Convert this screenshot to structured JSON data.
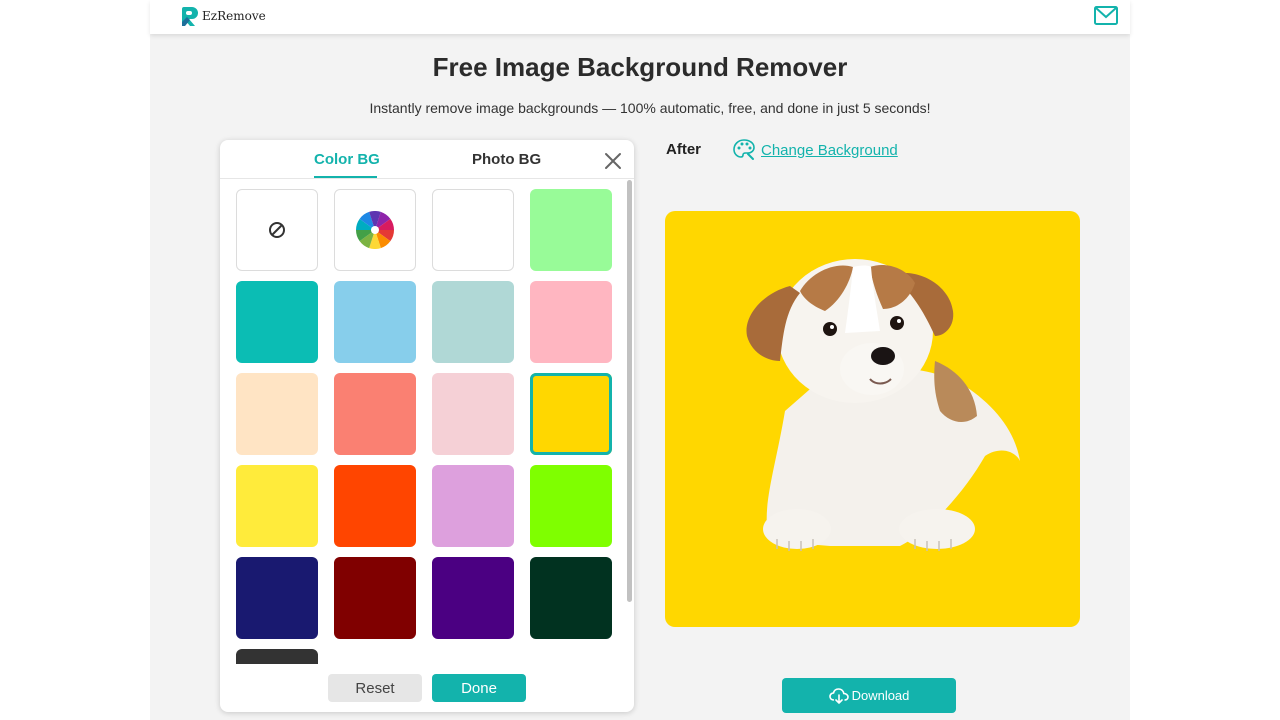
{
  "header": {
    "logo_text": "EzRemove",
    "brand_color": "#13b3ac",
    "mail_icon": "mail-icon"
  },
  "hero": {
    "title": "Free Image Background Remover",
    "subtitle": "Instantly remove image backgrounds — 100% automatic, free, and done in just 5 seconds!"
  },
  "bg_panel": {
    "tabs": [
      {
        "label": "Color BG",
        "active": true
      },
      {
        "label": "Photo BG",
        "active": false
      }
    ],
    "close_icon": "close-icon",
    "swatches": [
      {
        "type": "none",
        "icon": "no-background-icon"
      },
      {
        "type": "picker",
        "icon": "color-wheel-icon"
      },
      {
        "type": "color",
        "color": "#ffffff"
      },
      {
        "type": "color",
        "color": "#98fb98"
      },
      {
        "type": "color",
        "color": "#0bbdb4"
      },
      {
        "type": "color",
        "color": "#87ceeb"
      },
      {
        "type": "color",
        "color": "#b0d8d6"
      },
      {
        "type": "color",
        "color": "#ffb6c1"
      },
      {
        "type": "color",
        "color": "#ffe4c4"
      },
      {
        "type": "color",
        "color": "#fa8072"
      },
      {
        "type": "color",
        "color": "#f5d0d6"
      },
      {
        "type": "color",
        "color": "#ffd700",
        "selected": true
      },
      {
        "type": "color",
        "color": "#ffeb3b"
      },
      {
        "type": "color",
        "color": "#ff4500"
      },
      {
        "type": "color",
        "color": "#dda0dd"
      },
      {
        "type": "color",
        "color": "#7fff00"
      },
      {
        "type": "color",
        "color": "#191970"
      },
      {
        "type": "color",
        "color": "#800000"
      },
      {
        "type": "color",
        "color": "#4b0082"
      },
      {
        "type": "color",
        "color": "#013220"
      },
      {
        "type": "color",
        "color": "#333333"
      }
    ],
    "reset_label": "Reset",
    "done_label": "Done"
  },
  "result": {
    "after_label": "After",
    "change_bg_label": "Change Background",
    "background_color": "#ffd700",
    "download_label": "Download"
  }
}
